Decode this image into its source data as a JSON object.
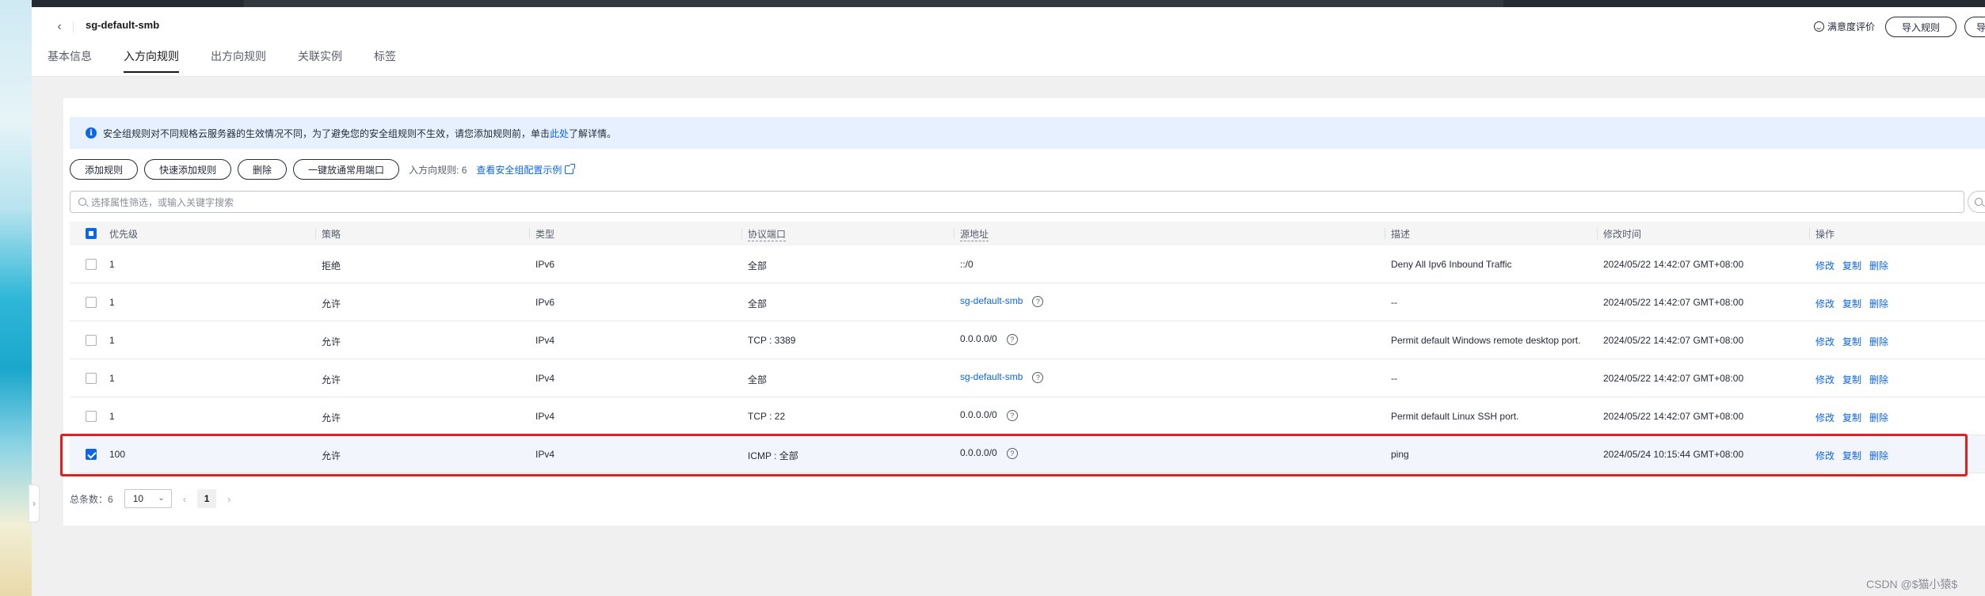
{
  "header": {
    "title": "sg-default-smb",
    "tabs": [
      "基本信息",
      "入方向规则",
      "出方向规则",
      "关联实例",
      "标签"
    ],
    "active_tab": "入方向规则",
    "rate_label": "满意度评价",
    "import_rule_label": "导入规则",
    "extra_button_label": "导"
  },
  "notice": {
    "text_before": "安全组规则对不同规格云服务器的生效情况不同，为了避免您的安全组规则不生效，请您添加规则前，单击",
    "link_text": "此处",
    "text_after": "了解详情。"
  },
  "toolbar": {
    "add_rule": "添加规则",
    "quick_add_rule": "快速添加规则",
    "delete": "删除",
    "open_common_ports": "一键放通常用端口",
    "inbound_count": "入方向规则: 6",
    "example_link": "查看安全组配置示例"
  },
  "search": {
    "placeholder": "选择属性筛选，或输入关键字搜索"
  },
  "table": {
    "columns": [
      "优先级",
      "策略",
      "类型",
      "协议端口",
      "源地址",
      "描述",
      "修改时间",
      "操作"
    ],
    "rows": [
      {
        "priority": "1",
        "policy": "拒绝",
        "type": "IPv6",
        "port": "全部",
        "source": "::/0",
        "source_is_link": false,
        "source_help": false,
        "desc": "Deny All Ipv6 Inbound Traffic",
        "time": "2024/05/22 14:42:07 GMT+08:00",
        "checked": false
      },
      {
        "priority": "1",
        "policy": "允许",
        "type": "IPv6",
        "port": "全部",
        "source": "sg-default-smb",
        "source_is_link": true,
        "source_help": true,
        "desc": "--",
        "time": "2024/05/22 14:42:07 GMT+08:00",
        "checked": false
      },
      {
        "priority": "1",
        "policy": "允许",
        "type": "IPv4",
        "port": "TCP : 3389",
        "source": "0.0.0.0/0",
        "source_is_link": false,
        "source_help": true,
        "desc": "Permit default Windows remote desktop port.",
        "time": "2024/05/22 14:42:07 GMT+08:00",
        "checked": false
      },
      {
        "priority": "1",
        "policy": "允许",
        "type": "IPv4",
        "port": "全部",
        "source": "sg-default-smb",
        "source_is_link": true,
        "source_help": true,
        "desc": "--",
        "time": "2024/05/22 14:42:07 GMT+08:00",
        "checked": false
      },
      {
        "priority": "1",
        "policy": "允许",
        "type": "IPv4",
        "port": "TCP : 22",
        "source": "0.0.0.0/0",
        "source_is_link": false,
        "source_help": true,
        "desc": "Permit default Linux SSH port.",
        "time": "2024/05/22 14:42:07 GMT+08:00",
        "checked": false
      },
      {
        "priority": "100",
        "policy": "允许",
        "type": "IPv4",
        "port": "ICMP : 全部",
        "source": "0.0.0.0/0",
        "source_is_link": false,
        "source_help": true,
        "desc": "ping",
        "time": "2024/05/24 10:15:44 GMT+08:00",
        "checked": true
      }
    ],
    "actions": [
      "修改",
      "复制",
      "删除"
    ]
  },
  "pager": {
    "total_label": "总条数：6",
    "page_size": "10",
    "current_page": "1"
  },
  "watermark": "CSDN @$猫小猿$",
  "colors": {
    "accent": "#0d66e5",
    "highlight_box": "#e02020"
  }
}
